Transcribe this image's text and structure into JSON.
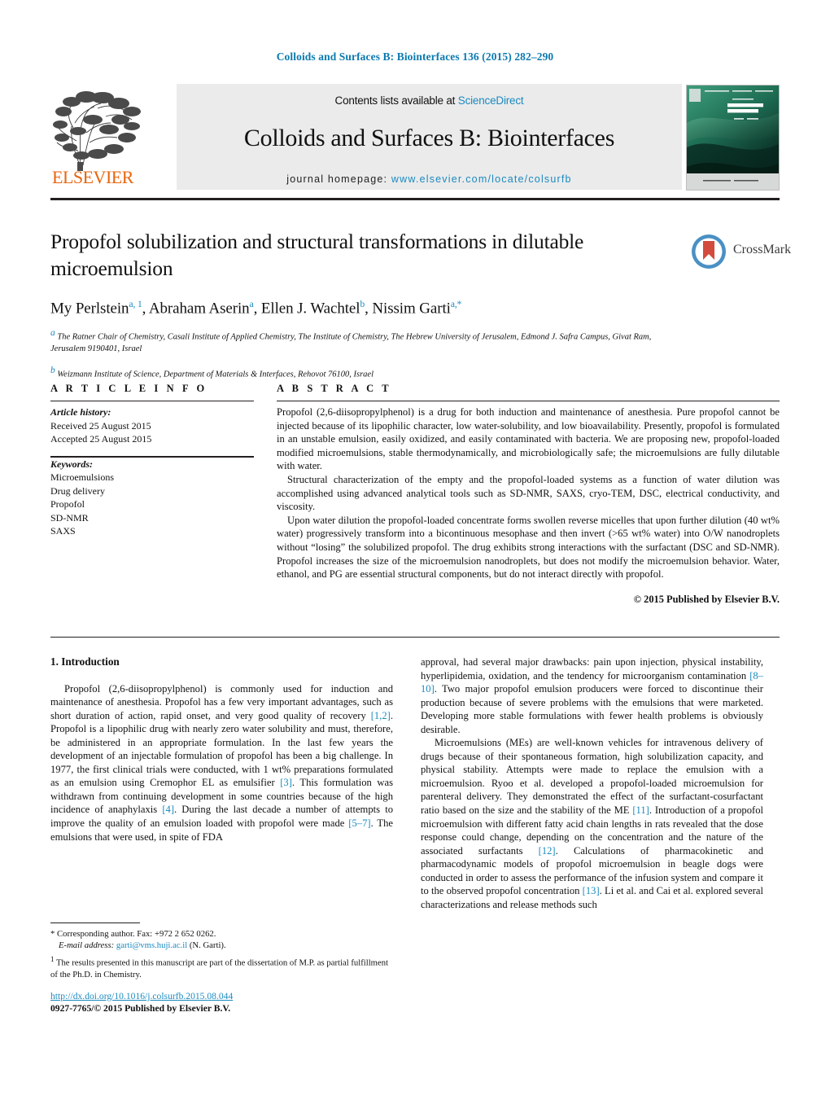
{
  "running_head": "Colloids and Surfaces B: Biointerfaces 136 (2015) 282–290",
  "masthead": {
    "contents_prefix": "Contents lists available at ",
    "sciencedirect": "ScienceDirect",
    "journal_title": "Colloids and Surfaces B: Biointerfaces",
    "homepage_prefix": "journal homepage: ",
    "homepage_url": "www.elsevier.com/locate/colsurfb",
    "publisher": "ELSEVIER",
    "cover_line1": "International Journal of",
    "cover_line2": "COLLOIDS AND",
    "cover_line3": "SURFACES B",
    "cover_sub": "Biointerfaces"
  },
  "article": {
    "title": "Propofol solubilization and structural transformations in dilutable microemulsion",
    "authors_html": "My Perlstein<sup>a, 1</sup>, Abraham Aserin<sup>a</sup>, Ellen J. Wachtel<sup>b</sup>, Nissim Garti<sup>a,*</sup>",
    "affiliation_a": "The Ratner Chair of Chemistry, Casali Institute of Applied Chemistry, The Institute of Chemistry, The Hebrew University of Jerusalem, Edmond J. Safra Campus, Givat Ram, Jerusalem 9190401, Israel",
    "affiliation_b": "Weizmann Institute of Science, Department of Materials & Interfaces, Rehovot 76100, Israel",
    "crossmark_label": "CrossMark"
  },
  "info": {
    "heading": "A R T I C L E  I N F O",
    "history_label": "Article history:",
    "received": "Received 25 August 2015",
    "accepted": "Accepted 25 August 2015",
    "keywords_label": "Keywords:",
    "keywords": [
      "Microemulsions",
      "Drug delivery",
      "Propofol",
      "SD-NMR",
      "SAXS"
    ]
  },
  "abstract": {
    "heading": "A B S T R A C T",
    "paragraphs": [
      "Propofol (2,6-diisopropylphenol) is a drug for both induction and maintenance of anesthesia. Pure propofol cannot be injected because of its lipophilic character, low water-solubility, and low bioavailability. Presently, propofol is formulated in an unstable emulsion, easily oxidized, and easily contaminated with bacteria. We are proposing new, propofol-loaded modified microemulsions, stable thermodynamically, and microbiologically safe; the microemulsions are fully dilutable with water.",
      "Structural characterization of the empty and the propofol-loaded systems as a function of water dilution was accomplished using advanced analytical tools such as SD-NMR, SAXS, cryo-TEM, DSC, electrical conductivity, and viscosity.",
      "Upon water dilution the propofol-loaded concentrate forms swollen reverse micelles that upon further dilution (40 wt% water) progressively transform into a bicontinuous mesophase and then invert (>65 wt% water) into O/W nanodroplets without “losing” the solubilized propofol. The drug exhibits strong interactions with the surfactant (DSC and SD-NMR). Propofol increases the size of the microemulsion nanodroplets, but does not modify the microemulsion behavior. Water, ethanol, and PG are essential structural components, but do not interact directly with propofol."
    ],
    "copyright": "© 2015 Published by Elsevier B.V."
  },
  "body": {
    "section_number_title": "1.  Introduction",
    "left_paragraphs": [
      "Propofol (2,6-diisopropylphenol) is commonly used for induction and maintenance of anesthesia. Propofol has a few very important advantages, such as short duration of action, rapid onset, and very good quality of recovery [1,2]. Propofol is a lipophilic drug with nearly zero water solubility and must, therefore, be administered in an appropriate formulation. In the last few years the development of an injectable formulation of propofol has been a big challenge. In 1977, the first clinical trials were conducted, with 1 wt% preparations formulated as an emulsion using Cremophor EL as emulsifier [3]. This formulation was withdrawn from continuing development in some countries because of the high incidence of anaphylaxis [4]. During the last decade a number of attempts to improve the quality of an emulsion loaded with propofol were made [5–7]. The emulsions that were used, in spite of FDA"
    ],
    "right_paragraphs": [
      "approval, had several major drawbacks: pain upon injection, physical instability, hyperlipidemia, oxidation, and the tendency for microorganism contamination [8–10]. Two major propofol emulsion producers were forced to discontinue their production because of severe problems with the emulsions that were marketed. Developing more stable formulations with fewer health problems is obviously desirable.",
      "Microemulsions (MEs) are well-known vehicles for intravenous delivery of drugs because of their spontaneous formation, high solubilization capacity, and physical stability. Attempts were made to replace the emulsion with a microemulsion. Ryoo et al. developed a propofol-loaded microemulsion for parenteral delivery. They demonstrated the effect of the surfactant-cosurfactant ratio based on the size and the stability of the ME [11]. Introduction of a propofol microemulsion with different fatty acid chain lengths in rats revealed that the dose response could change, depending on the concentration and the nature of the associated surfactants [12]. Calculations of pharmacokinetic and pharmacodynamic models of propofol microemulsion in beagle dogs were conducted in order to assess the performance of the infusion system and compare it to the observed propofol concentration [13]. Li et al. and Cai et al. explored several characterizations and release methods such"
    ]
  },
  "footnotes": {
    "corresponding": "Corresponding author. Fax: +972 2 652 0262.",
    "email_label": "E-mail address:",
    "email": "garti@vms.huji.ac.il",
    "email_suffix": "(N. Garti).",
    "note1": "The results presented in this manuscript are part of the dissertation of M.P. as partial fulfillment of the Ph.D. in Chemistry.",
    "doi": "http://dx.doi.org/10.1016/j.colsurfb.2015.08.044",
    "issn_line": "0927-7765/© 2015 Published by Elsevier B.V."
  },
  "colors": {
    "link_blue": "#1a8ac0",
    "header_blue": "#0b7ab0",
    "elsevier_orange": "#e8650d",
    "masthead_gray": "#ebebeb",
    "cover_green": "#2e8b6b",
    "crossmark_blue": "#4a90c4",
    "crossmark_red": "#d24b3c"
  }
}
